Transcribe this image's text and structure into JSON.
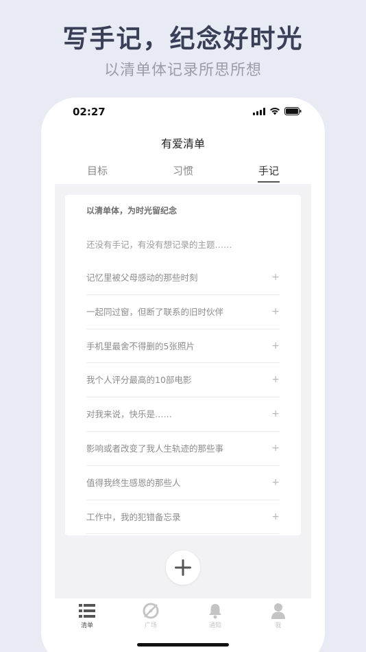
{
  "promo": {
    "headline": "写手记，纪念好时光",
    "subheadline": "以清单体记录所思所想"
  },
  "status_bar": {
    "time": "02:27"
  },
  "nav": {
    "title": "有爱清单"
  },
  "tabs": [
    {
      "label": "目标",
      "active": false
    },
    {
      "label": "习惯",
      "active": false
    },
    {
      "label": "手记",
      "active": true
    }
  ],
  "card": {
    "header": "以清单体，为时光留纪念",
    "empty_text": "还没有手记，有没有想记录的主题……",
    "plus_symbol": "+",
    "prompts": [
      "记忆里被父母感动的那些时刻",
      "一起同过窗，但断了联系的旧时伙伴",
      "手机里最舍不得删的5张照片",
      "我个人评分最高的10部电影",
      "对我来说，快乐是……",
      "影响或者改变了我人生轨迹的那些事",
      "值得我终生感恩的那些人",
      "工作中，我的犯错备忘录"
    ]
  },
  "fab": {
    "icon": "plus-icon"
  },
  "tabbar": [
    {
      "label": "清单",
      "icon": "list-icon",
      "active": true
    },
    {
      "label": "广场",
      "icon": "compass-icon",
      "active": false
    },
    {
      "label": "通知",
      "icon": "bell-icon",
      "active": false
    },
    {
      "label": "我",
      "icon": "person-icon",
      "active": false
    }
  ],
  "colors": {
    "background": "#e8eaf4",
    "headline": "#3a3f58",
    "active_tab": "#333333",
    "inactive_icon": "#c4c4c4"
  }
}
